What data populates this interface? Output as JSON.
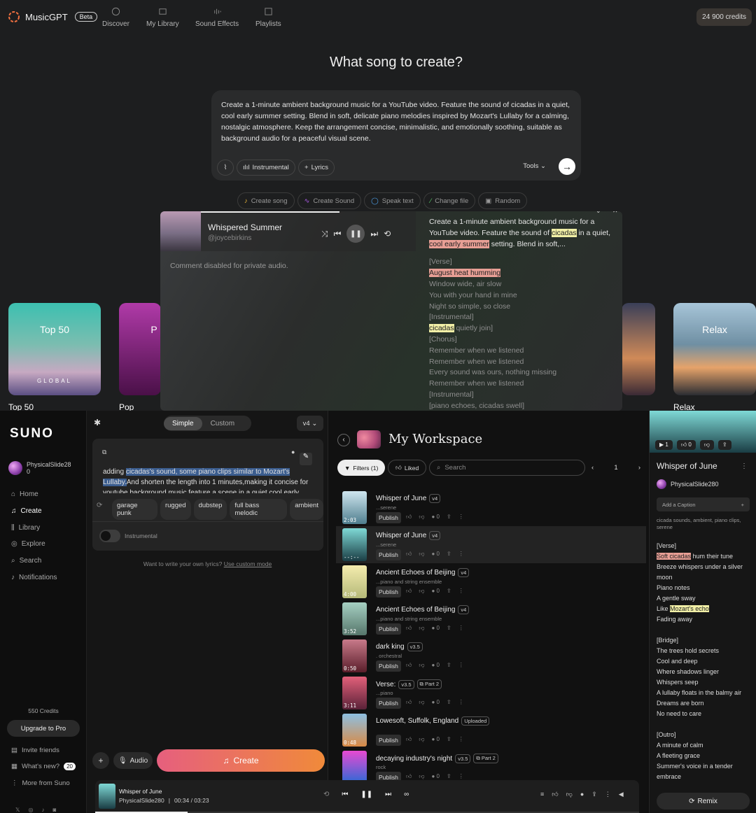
{
  "musicgpt": {
    "brand": "MusicGPT",
    "beta": "Beta",
    "nav": [
      "Discover",
      "My Library",
      "Sound Effects",
      "Playlists"
    ],
    "credits": "24 900 credits",
    "headline": "What song to create?",
    "prompt": "Create a 1-minute ambient background music for a YouTube video. Feature the sound of cicadas in a quiet, cool early summer setting. Blend in soft, delicate piano melodies inspired by Mozart's Lullaby for a calming, nostalgic atmosphere. Keep the arrangement concise, minimalistic, and emotionally soothing, suitable as background audio for a peaceful visual scene.",
    "chips": {
      "instrumental": "Instrumental",
      "lyrics": "Lyrics",
      "tools": "Tools"
    },
    "actions": [
      "Create song",
      "Create Sound",
      "Speak text",
      "Change file",
      "Random"
    ],
    "cards": [
      {
        "title": "Top 50",
        "sub": "GLOBAL",
        "label": "Top 50"
      },
      {
        "title": "P",
        "label": "Pop"
      },
      {
        "title": "Relax",
        "label": "Relax"
      }
    ],
    "popup": {
      "title": "Whispered Summer",
      "user": "@joycebirkins",
      "comment": "Comment disabled for private audio.",
      "desc_a": "Create a 1-minute ambient background music for a YouTube video. Feature the sound of ",
      "desc_hl1": "cicadas",
      "desc_b": " in a quiet, ",
      "desc_hl2": "cool early summer",
      "desc_c": " setting. Blend in soft,...",
      "lyrics": [
        "[Verse]",
        "August heat humming",
        "Window wide, air slow",
        "You with your hand in mine",
        "Night so simple, so close",
        "[Instrumental]",
        "cicadas quietly join]",
        "[Chorus]",
        "Remember when we listened",
        "Remember when we listened",
        "Every sound was ours, nothing missing",
        "Remember when we listened",
        "[Instrumental]",
        "[piano echoes, cicadas swell]"
      ]
    }
  },
  "suno": {
    "logo": "SUNO",
    "user": "PhysicalSlide28",
    "user_count": "0",
    "nav": [
      "Home",
      "Create",
      "Library",
      "Explore",
      "Search",
      "Notifications"
    ],
    "credits": "550 Credits",
    "upgrade": "Upgrade to Pro",
    "bottom_nav": [
      "Invite friends",
      "What's new?",
      "More from Suno"
    ],
    "whats_new_count": "20",
    "mode": {
      "simple": "Simple",
      "custom": "Custom",
      "version": "v4"
    },
    "desc_a": "adding ",
    "desc_sel": "cicadas's sound, some piano clips similar to Mozart's Lullaby.",
    "desc_b": "And shorten the length into 1 minutes,making it concise for youtube background music feature a scene in a quiet cool early summer",
    "tags": [
      "garage punk",
      "rugged",
      "dubstep",
      "full bass melodic",
      "ambient"
    ],
    "instrumental": "Instrumental",
    "custom_hint": "Want to write your own lyrics?",
    "custom_link": "Use custom mode",
    "audio": "Audio",
    "create": "Create",
    "workspace_title": "My Workspace",
    "filters": "Filters (1)",
    "liked": "Liked",
    "search_ph": "Search",
    "page": "1",
    "publish": "Publish",
    "rows": [
      {
        "title": "Whisper of June",
        "ver": "v4",
        "sub": "...serene",
        "dur": "2:03",
        "colors": [
          "#cfe6ef",
          "#4f7e8e"
        ]
      },
      {
        "title": "Whisper of June",
        "ver": "v4",
        "sub": "...serene",
        "dur": "--:--",
        "colors": [
          "#7fd9d6",
          "#1a3d44"
        ]
      },
      {
        "title": "Ancient Echoes of Beijing",
        "ver": "v4",
        "sub": "...piano and string ensemble",
        "dur": "4:00",
        "colors": [
          "#f4ecae",
          "#b5b979"
        ]
      },
      {
        "title": "Ancient Echoes of Beijing",
        "ver": "v4",
        "sub": "...piano and string ensemble",
        "dur": "3:52",
        "colors": [
          "#a6d0c2",
          "#56766b"
        ]
      },
      {
        "title": "dark king",
        "ver": "v3.5",
        "sub": ". orchestral",
        "dur": "0:50",
        "colors": [
          "#c87a8a",
          "#5a1e2a"
        ]
      },
      {
        "title": "Verse:",
        "ver": "v3.5",
        "part": "Part 2",
        "sub": "...piano",
        "dur": "3:11",
        "colors": [
          "#e2607a",
          "#5a2238"
        ]
      },
      {
        "title": "Lowesoft, Suffolk, England",
        "ver": "Uploaded",
        "sub": "",
        "dur": "0:48",
        "colors": [
          "#8ec0e2",
          "#d88a45"
        ]
      },
      {
        "title": "decaying industry's night",
        "ver": "v3.5",
        "part": "Part 2",
        "sub": "rock",
        "dur": "",
        "colors": [
          "#e94ad2",
          "#2a6ad6"
        ]
      }
    ],
    "right": {
      "title": "Whisper of June",
      "user": "PhysicalSlide280",
      "caption_ph": "Add a Caption",
      "tags": "cicada sounds, ambient, piano clips, serene",
      "stats": [
        "1",
        "0"
      ],
      "lyrics_hl": [
        "Soft cicadas",
        "Mozart's echo"
      ],
      "lyrics": [
        "[Verse]",
        "Soft cicadas hum their tune",
        "Breeze whispers under a silver moon",
        "Piano notes",
        "A gentle sway",
        "Like Mozart's echo",
        "Fading away",
        "",
        "[Bridge]",
        "The trees hold secrets",
        "Cool and deep",
        "Where shadows linger",
        "Whispers seep",
        "A lullaby floats in the balmy air",
        "Dreams are born",
        "No need to care",
        "",
        "[Outro]",
        "A minute of calm",
        "A fleeting grace",
        "Summer's voice in a tender embrace"
      ],
      "remix": "Remix"
    },
    "player": {
      "title": "Whisper of June",
      "user": "PhysicalSlide280",
      "time": "00:34 / 03:23",
      "progress": 0.17
    }
  }
}
